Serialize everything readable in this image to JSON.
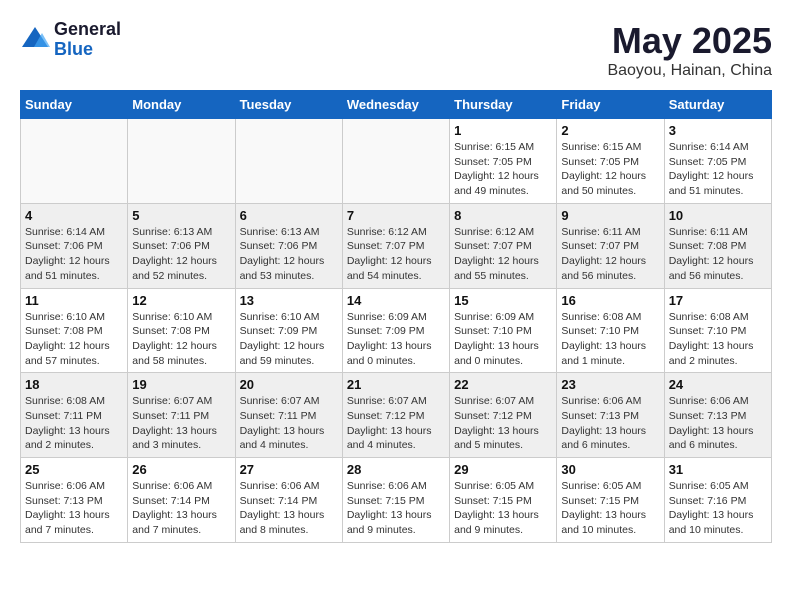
{
  "header": {
    "logo_general": "General",
    "logo_blue": "Blue",
    "month": "May 2025",
    "location": "Baoyou, Hainan, China"
  },
  "weekdays": [
    "Sunday",
    "Monday",
    "Tuesday",
    "Wednesday",
    "Thursday",
    "Friday",
    "Saturday"
  ],
  "weeks": [
    [
      {
        "day": "",
        "info": ""
      },
      {
        "day": "",
        "info": ""
      },
      {
        "day": "",
        "info": ""
      },
      {
        "day": "",
        "info": ""
      },
      {
        "day": "1",
        "info": "Sunrise: 6:15 AM\nSunset: 7:05 PM\nDaylight: 12 hours\nand 49 minutes."
      },
      {
        "day": "2",
        "info": "Sunrise: 6:15 AM\nSunset: 7:05 PM\nDaylight: 12 hours\nand 50 minutes."
      },
      {
        "day": "3",
        "info": "Sunrise: 6:14 AM\nSunset: 7:05 PM\nDaylight: 12 hours\nand 51 minutes."
      }
    ],
    [
      {
        "day": "4",
        "info": "Sunrise: 6:14 AM\nSunset: 7:06 PM\nDaylight: 12 hours\nand 51 minutes."
      },
      {
        "day": "5",
        "info": "Sunrise: 6:13 AM\nSunset: 7:06 PM\nDaylight: 12 hours\nand 52 minutes."
      },
      {
        "day": "6",
        "info": "Sunrise: 6:13 AM\nSunset: 7:06 PM\nDaylight: 12 hours\nand 53 minutes."
      },
      {
        "day": "7",
        "info": "Sunrise: 6:12 AM\nSunset: 7:07 PM\nDaylight: 12 hours\nand 54 minutes."
      },
      {
        "day": "8",
        "info": "Sunrise: 6:12 AM\nSunset: 7:07 PM\nDaylight: 12 hours\nand 55 minutes."
      },
      {
        "day": "9",
        "info": "Sunrise: 6:11 AM\nSunset: 7:07 PM\nDaylight: 12 hours\nand 56 minutes."
      },
      {
        "day": "10",
        "info": "Sunrise: 6:11 AM\nSunset: 7:08 PM\nDaylight: 12 hours\nand 56 minutes."
      }
    ],
    [
      {
        "day": "11",
        "info": "Sunrise: 6:10 AM\nSunset: 7:08 PM\nDaylight: 12 hours\nand 57 minutes."
      },
      {
        "day": "12",
        "info": "Sunrise: 6:10 AM\nSunset: 7:08 PM\nDaylight: 12 hours\nand 58 minutes."
      },
      {
        "day": "13",
        "info": "Sunrise: 6:10 AM\nSunset: 7:09 PM\nDaylight: 12 hours\nand 59 minutes."
      },
      {
        "day": "14",
        "info": "Sunrise: 6:09 AM\nSunset: 7:09 PM\nDaylight: 13 hours\nand 0 minutes."
      },
      {
        "day": "15",
        "info": "Sunrise: 6:09 AM\nSunset: 7:10 PM\nDaylight: 13 hours\nand 0 minutes."
      },
      {
        "day": "16",
        "info": "Sunrise: 6:08 AM\nSunset: 7:10 PM\nDaylight: 13 hours\nand 1 minute."
      },
      {
        "day": "17",
        "info": "Sunrise: 6:08 AM\nSunset: 7:10 PM\nDaylight: 13 hours\nand 2 minutes."
      }
    ],
    [
      {
        "day": "18",
        "info": "Sunrise: 6:08 AM\nSunset: 7:11 PM\nDaylight: 13 hours\nand 2 minutes."
      },
      {
        "day": "19",
        "info": "Sunrise: 6:07 AM\nSunset: 7:11 PM\nDaylight: 13 hours\nand 3 minutes."
      },
      {
        "day": "20",
        "info": "Sunrise: 6:07 AM\nSunset: 7:11 PM\nDaylight: 13 hours\nand 4 minutes."
      },
      {
        "day": "21",
        "info": "Sunrise: 6:07 AM\nSunset: 7:12 PM\nDaylight: 13 hours\nand 4 minutes."
      },
      {
        "day": "22",
        "info": "Sunrise: 6:07 AM\nSunset: 7:12 PM\nDaylight: 13 hours\nand 5 minutes."
      },
      {
        "day": "23",
        "info": "Sunrise: 6:06 AM\nSunset: 7:13 PM\nDaylight: 13 hours\nand 6 minutes."
      },
      {
        "day": "24",
        "info": "Sunrise: 6:06 AM\nSunset: 7:13 PM\nDaylight: 13 hours\nand 6 minutes."
      }
    ],
    [
      {
        "day": "25",
        "info": "Sunrise: 6:06 AM\nSunset: 7:13 PM\nDaylight: 13 hours\nand 7 minutes."
      },
      {
        "day": "26",
        "info": "Sunrise: 6:06 AM\nSunset: 7:14 PM\nDaylight: 13 hours\nand 7 minutes."
      },
      {
        "day": "27",
        "info": "Sunrise: 6:06 AM\nSunset: 7:14 PM\nDaylight: 13 hours\nand 8 minutes."
      },
      {
        "day": "28",
        "info": "Sunrise: 6:06 AM\nSunset: 7:15 PM\nDaylight: 13 hours\nand 9 minutes."
      },
      {
        "day": "29",
        "info": "Sunrise: 6:05 AM\nSunset: 7:15 PM\nDaylight: 13 hours\nand 9 minutes."
      },
      {
        "day": "30",
        "info": "Sunrise: 6:05 AM\nSunset: 7:15 PM\nDaylight: 13 hours\nand 10 minutes."
      },
      {
        "day": "31",
        "info": "Sunrise: 6:05 AM\nSunset: 7:16 PM\nDaylight: 13 hours\nand 10 minutes."
      }
    ]
  ]
}
